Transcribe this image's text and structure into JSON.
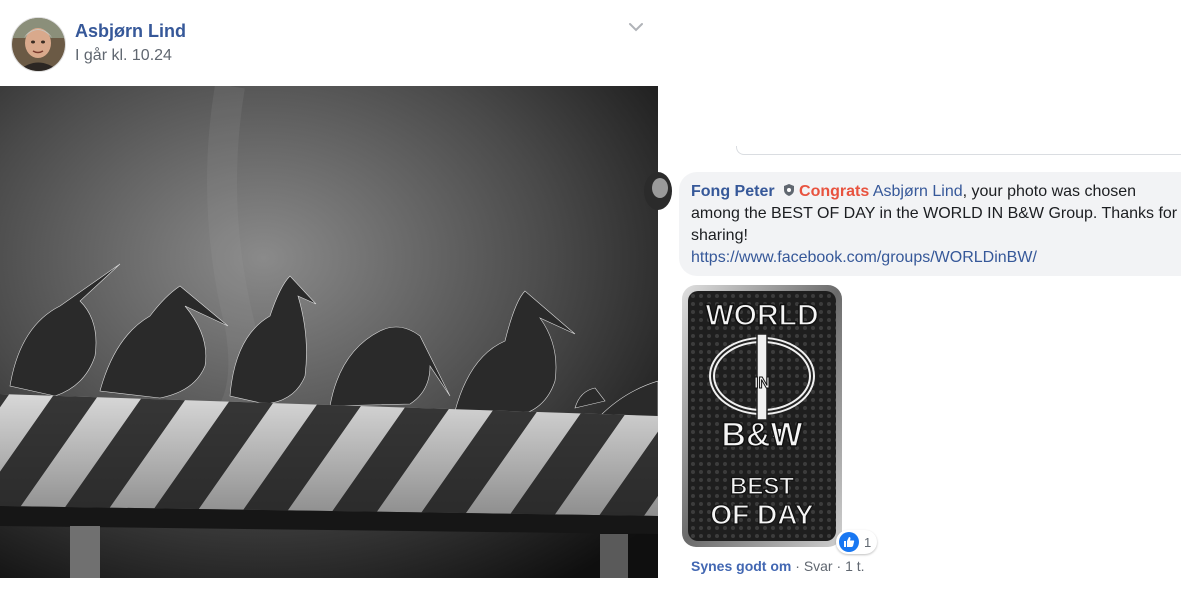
{
  "post": {
    "author_name": "Asbjørn Lind",
    "timestamp": "I går kl. 10.24",
    "options_icon": "chevron-down-icon"
  },
  "comment": {
    "author_name": "Fong Peter",
    "badge_icon": "shield-badge-icon",
    "congrats": "Congrats",
    "mention": "Asbjørn Lind",
    "text_rest": ", your photo was chosen among the BEST OF DAY in the WORLD IN B&W Group. Thanks for sharing!",
    "link": "https://www.facebook.com/groups/WORLDinBW/",
    "sticker": {
      "line1": "WORLD",
      "line2": "IN",
      "line3": "B&W",
      "line4": "BEST",
      "line5": "OF DAY"
    },
    "reaction_icon": "like-icon",
    "reaction_count": "1",
    "actions": {
      "like": "Synes godt om",
      "separator": " · ",
      "reply": "Svar",
      "time": "1 t."
    }
  },
  "colors": {
    "link_blue": "#365899",
    "congrats_red": "#e8533f",
    "bubble_bg": "#f2f3f5",
    "like_blue": "#1877f2"
  }
}
